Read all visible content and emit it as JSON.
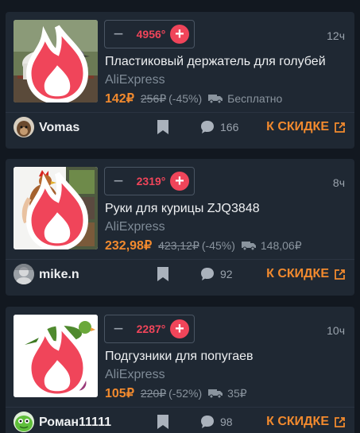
{
  "deals": [
    {
      "temperature": "4956°",
      "time": "12ч",
      "title": "Пластиковый держатель для голубей",
      "merchant": "AliExpress",
      "price": "142₽",
      "old_price": "256₽",
      "discount": "(-45%)",
      "shipping": "Бесплатно",
      "user": "Vomas",
      "comments": "166",
      "cta": "К СКИДКЕ",
      "image_icon": "pigeon-holder-image"
    },
    {
      "temperature": "2319°",
      "time": "8ч",
      "title": "Руки для курицы ZJQ3848",
      "merchant": "AliExpress",
      "price": "232,98₽",
      "old_price": "423,12₽",
      "discount": "(-45%)",
      "shipping": "148,06₽",
      "user": "mike.n",
      "comments": "92",
      "cta": "К СКИДКЕ",
      "image_icon": "chicken-arms-image"
    },
    {
      "temperature": "2287°",
      "time": "10ч",
      "title": "Подгузники для попугаев",
      "merchant": "AliExpress",
      "price": "105₽",
      "old_price": "220₽",
      "discount": "(-52%)",
      "shipping": "35₽",
      "user": "Роман11111",
      "comments": "98",
      "cta": "К СКИДКЕ",
      "image_icon": "parrot-diaper-image"
    }
  ],
  "colors": {
    "background": "#121820",
    "card": "#1f2833",
    "hot_red": "#f0455a",
    "price_orange": "#f28a2e",
    "muted": "#8a949e"
  }
}
